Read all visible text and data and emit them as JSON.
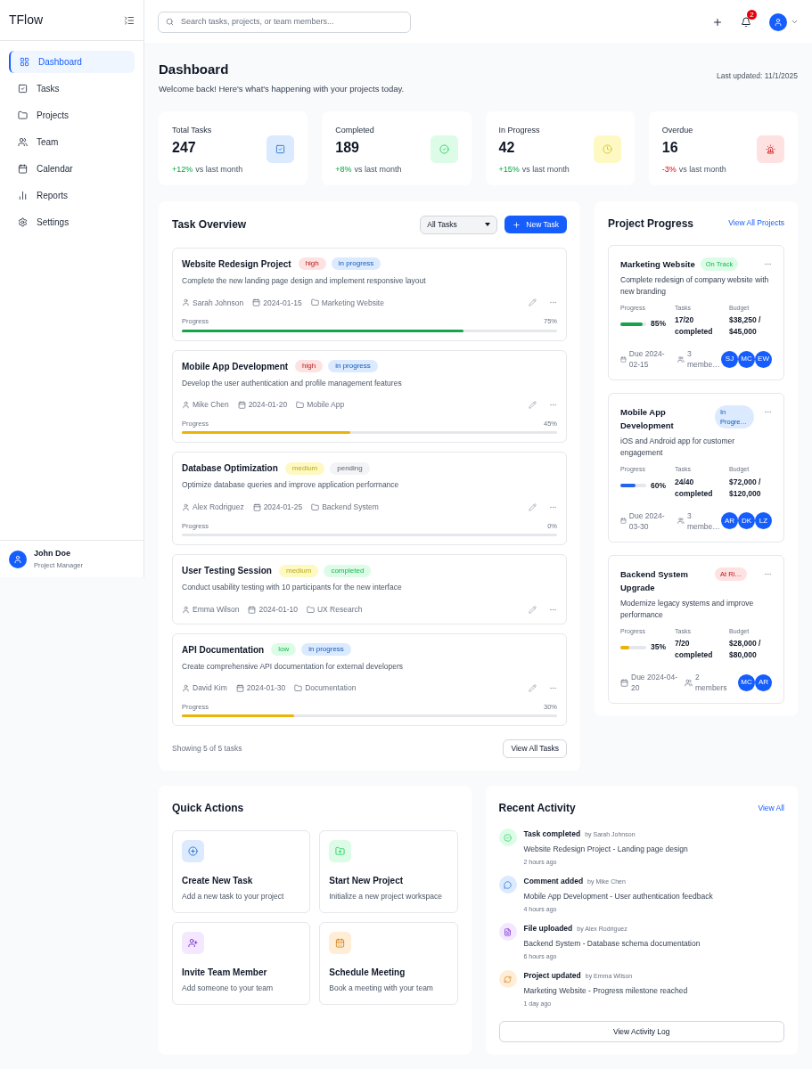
{
  "sidebar": {
    "brand": "TFlow",
    "items": [
      {
        "kind": "grid",
        "label": "Dashboard",
        "selected": true
      },
      {
        "kind": "check",
        "label": "Tasks",
        "selected": false
      },
      {
        "kind": "folder",
        "label": "Projects",
        "selected": false
      },
      {
        "kind": "team",
        "label": "Team",
        "selected": false
      },
      {
        "kind": "calendar",
        "label": "Calendar",
        "selected": false
      },
      {
        "kind": "chart",
        "label": "Reports",
        "selected": false
      },
      {
        "kind": "settings",
        "label": "Settings",
        "selected": false
      }
    ],
    "user": {
      "name": "John Doe",
      "role": "Project Manager"
    }
  },
  "header": {
    "search": {
      "placeholder": "Search tasks, projects, or team members..."
    },
    "notification_count": "2"
  },
  "page": {
    "title": "Dashboard",
    "subtitle": "Welcome back! Here's what's happening with your projects today.",
    "last_updated": "Last updated: 11/1/2025"
  },
  "stats": [
    {
      "label": "Total Tasks",
      "value": "247",
      "delta": "+12%",
      "delta_note": "vs last month",
      "positive": true,
      "kind": "tasks",
      "color": "#dbeafe"
    },
    {
      "label": "Completed",
      "value": "189",
      "delta": "+8%",
      "delta_note": "vs last month",
      "positive": true,
      "kind": "completed",
      "color": "#dcfce7"
    },
    {
      "label": "In Progress",
      "value": "42",
      "delta": "+15%",
      "delta_note": "vs last month",
      "positive": true,
      "kind": "progress",
      "color": "#fef9c3"
    },
    {
      "label": "Overdue",
      "value": "16",
      "delta": "-3%",
      "delta_note": "vs last month",
      "positive": false,
      "kind": "overdue",
      "color": "#fee2e2"
    }
  ],
  "task_overview": {
    "title": "Task Overview",
    "filter": "All Tasks",
    "new_button": "New Task",
    "tasks": [
      {
        "title": "Website Redesign Project",
        "priority": {
          "label": "high",
          "color": "#fee2e2"
        },
        "status": {
          "label": "in progress",
          "color": "#dbeafe"
        },
        "description": "Complete the new landing page design and implement responsive layout",
        "assignee": "Sarah Johnson",
        "date": "2024-01-15",
        "project": "Marketing Website",
        "progress": {
          "label": "Progress",
          "reading": "75%",
          "level": 0.75,
          "color": "#16a34a"
        }
      },
      {
        "title": "Mobile App Development",
        "priority": {
          "label": "high",
          "color": "#fee2e2"
        },
        "status": {
          "label": "in progress",
          "color": "#dbeafe"
        },
        "description": "Develop the user authentication and profile management features",
        "assignee": "Mike Chen",
        "date": "2024-01-20",
        "project": "Mobile App",
        "progress": {
          "label": "Progress",
          "reading": "45%",
          "level": 0.45,
          "color": "#eab308"
        }
      },
      {
        "title": "Database Optimization",
        "priority": {
          "label": "medium",
          "color": "#fef9c3"
        },
        "status": {
          "label": "pending",
          "color": "#f3f4f6"
        },
        "description": "Optimize database queries and improve application performance",
        "assignee": "Alex Rodriguez",
        "date": "2024-01-25",
        "project": "Backend System",
        "progress": {
          "label": "Progress",
          "reading": "0%",
          "level": 0
        }
      },
      {
        "title": "User Testing Session",
        "priority": {
          "label": "medium",
          "color": "#fef9c3"
        },
        "status": {
          "label": "completed",
          "color": "#dcfce7"
        },
        "description": "Conduct usability testing with 10 participants for the new interface",
        "assignee": "Emma Wilson",
        "date": "2024-01-10",
        "project": "UX Research"
      },
      {
        "title": "API Documentation",
        "priority": {
          "label": "low",
          "color": "#dcfce7"
        },
        "status": {
          "label": "in progress",
          "color": "#dbeafe"
        },
        "description": "Create comprehensive API documentation for external developers",
        "assignee": "David Kim",
        "date": "2024-01-30",
        "project": "Documentation",
        "progress": {
          "label": "Progress",
          "reading": "30%",
          "level": 0.3,
          "color": "#eab308"
        }
      }
    ],
    "footer": "Showing 5 of 5 tasks",
    "view_all": "View All Tasks"
  },
  "project_progress": {
    "title": "Project Progress",
    "view_all": "View All Projects",
    "projects": [
      {
        "name": "Marketing Website",
        "status": {
          "label": "On Track",
          "color": "#dcfce7"
        },
        "description": "Complete redesign of company website with new branding",
        "progress": {
          "label": "Progress",
          "level": 0.85,
          "color": "#16a34a",
          "reading": "85%"
        },
        "tasks_label": "Tasks",
        "tasks": "17/20 completed",
        "budget_label": "Budget",
        "budget": "$38,250 / $45,000",
        "due": "Due 2024-02-15",
        "members": "3 membe…",
        "avatars": [
          "SJ",
          "MC",
          "EW"
        ]
      },
      {
        "name": "Mobile App Development",
        "status": {
          "label": "In Progre…",
          "color": "#dbeafe"
        },
        "description": "iOS and Android app for customer engagement",
        "progress": {
          "label": "Progress",
          "level": 0.6,
          "color": "#2563eb",
          "reading": "60%"
        },
        "tasks_label": "Tasks",
        "tasks": "24/40 completed",
        "budget_label": "Budget",
        "budget": "$72,000 / $120,000",
        "due": "Due 2024-03-30",
        "members": "3 membe…",
        "avatars": [
          "AR",
          "DK",
          "LZ"
        ]
      },
      {
        "name": "Backend System Upgrade",
        "status": {
          "label": "At Ri…",
          "color": "#fee2e2"
        },
        "description": "Modernize legacy systems and improve performance",
        "progress": {
          "label": "Progress",
          "level": 0.35,
          "color": "#eab308",
          "reading": "35%"
        },
        "tasks_label": "Tasks",
        "tasks": "7/20 completed",
        "budget_label": "Budget",
        "budget": "$28,000 / $80,000",
        "due": "Due 2024-04-20",
        "members": "2 members",
        "avatars": [
          "MC",
          "AR"
        ]
      }
    ]
  },
  "quick_actions": {
    "title": "Quick Actions",
    "actions": [
      {
        "kind": "plus",
        "color": "#dbeafe",
        "title": "Create New Task",
        "description": "Add a new task to your project"
      },
      {
        "kind": "folder-plus",
        "color": "#dcfce7",
        "title": "Start New Project",
        "description": "Initialize a new project workspace"
      },
      {
        "kind": "user-plus",
        "color": "#f3e8ff",
        "title": "Invite Team Member",
        "description": "Add someone to your team"
      },
      {
        "kind": "calendar",
        "color": "#ffedd5",
        "title": "Schedule Meeting",
        "description": "Book a meeting with your team"
      }
    ]
  },
  "recent_activity": {
    "title": "Recent Activity",
    "view_all": "View All",
    "items": [
      {
        "kind": "check",
        "color": "#dcfce7",
        "action": "Task completed",
        "by": "by Sarah Johnson",
        "detail": "Website Redesign Project - Landing page design",
        "time": "2 hours ago"
      },
      {
        "kind": "comment",
        "color": "#dbeafe",
        "action": "Comment added",
        "by": "by Mike Chen",
        "detail": "Mobile App Development - User authentication feedback",
        "time": "4 hours ago"
      },
      {
        "kind": "file",
        "color": "#f3e8ff",
        "action": "File uploaded",
        "by": "by Alex Rodriguez",
        "detail": "Backend System - Database schema documentation",
        "time": "6 hours ago"
      },
      {
        "kind": "refresh",
        "color": "#ffedd5",
        "action": "Project updated",
        "by": "by Emma Wilson",
        "detail": "Marketing Website - Progress milestone reached",
        "time": "1 day ago"
      }
    ],
    "log_button": "View Activity Log"
  }
}
